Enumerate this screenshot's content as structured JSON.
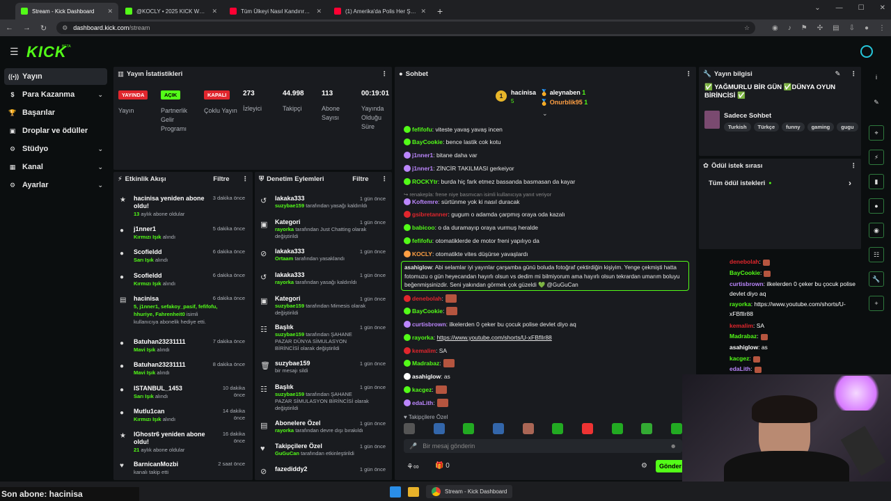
{
  "browser": {
    "tabs": [
      {
        "label": "Stream - Kick Dashboard",
        "color": "#53fc18"
      },
      {
        "label": "@KOCLY • 2025 KICK WRAPPE",
        "color": "#53fc18"
      },
      {
        "label": "Tüm Ülkeyi Nasıl Kandırırsın? -",
        "color": "#ff0033"
      },
      {
        "label": "(1) Amerika'da Polis Her Şeyi G",
        "color": "#ff0033"
      }
    ],
    "url_host": "dashboard.kick.com",
    "url_path": "/stream"
  },
  "app": {
    "logo": "KICK",
    "beta": "BETA"
  },
  "sidebar": [
    {
      "label": "Yayın",
      "icon": "broadcast-icon",
      "selected": true
    },
    {
      "label": "Para Kazanma",
      "icon": "dollar-icon",
      "chevron": true
    },
    {
      "label": "Başarılar",
      "icon": "trophy-icon"
    },
    {
      "label": "Droplar ve ödüller",
      "icon": "gift-icon"
    },
    {
      "label": "Stüdyo",
      "icon": "settings-icon",
      "chevron": true
    },
    {
      "label": "Kanal",
      "icon": "channel-icon",
      "chevron": true
    },
    {
      "label": "Ayarlar",
      "icon": "gear-icon",
      "chevron": true
    }
  ],
  "stats": {
    "title": "Yayın İstatistikleri",
    "items": [
      {
        "pill": "YAYINDA",
        "color": "#e1262d",
        "label": "Yayın"
      },
      {
        "pill": "AÇIK",
        "color": "#53fc18",
        "label": "Partnerlik Gelir Programı"
      },
      {
        "pill": "KAPALI",
        "color": "#e1262d",
        "label": "Çoklu Yayın"
      },
      {
        "value": "273",
        "label": "İzleyici"
      },
      {
        "value": "44.998",
        "label": "Takipçi"
      },
      {
        "value": "113",
        "label": "Abone Sayısı"
      },
      {
        "value": "00:19:01",
        "label": "Yayında Olduğu Süre"
      }
    ]
  },
  "activity": {
    "title": "Etkinlik Akışı",
    "filter": "Filtre",
    "rows": [
      {
        "name": "hacinisa yeniden abone oldu!",
        "sub_hi": "13",
        "sub": " aylık abone oldular",
        "time": "3 dakika önce"
      },
      {
        "name": "j1nner1",
        "sub_hi": "Kırmızı Işık",
        "sub": " alındı",
        "time": "5 dakika önce"
      },
      {
        "name": "Scofieldd",
        "sub_hi": "Sarı Işık",
        "sub": " alındı",
        "time": "6 dakika önce"
      },
      {
        "name": "Scofieldd",
        "sub_hi": "Kırmızı Işık",
        "sub": " alındı",
        "time": "6 dakika önce"
      },
      {
        "name": "hacinisa",
        "sub_hi": "5, j1nner1, sefakoy_pasif, fefifofu, hhuriye, Fahrenheit0",
        "sub": " isimli kullanıcıya abonelik hediye etti.",
        "time": "6 dakika önce"
      },
      {
        "name": "Batuhan23231111",
        "sub_hi": "Mavi Işık",
        "sub": " alındı",
        "time": "7 dakika önce"
      },
      {
        "name": "Batuhan23231111",
        "sub_hi": "Mavi Işık",
        "sub": " alındı",
        "time": "8 dakika önce"
      },
      {
        "name": "ISTANBUL_1453",
        "sub_hi": "Sarı Işık",
        "sub": " alındı",
        "time": "10 dakika önce"
      },
      {
        "name": "Mutlu1can",
        "sub_hi": "Kırmızı Işık",
        "sub": " alındı",
        "time": "14 dakika önce"
      },
      {
        "name": "lGhostr6 yeniden abone oldu!",
        "sub_hi": "21",
        "sub": " aylık abone oldular",
        "time": "16 dakika önce"
      },
      {
        "name": "BarnicanMozbi",
        "sub_hi": "",
        "sub": "kanalı takip etti",
        "time": "2 saat önce"
      }
    ]
  },
  "moderation": {
    "title": "Denetim Eylemleri",
    "filter": "Filtre",
    "rows": [
      {
        "name": "lakaka333",
        "hi": "suzybae159",
        "sub": " tarafından yasağı kaldırıldı",
        "time": "1 gün önce"
      },
      {
        "name": "Kategori",
        "hi": "rayorka",
        "sub": " tarafından Just Chatting olarak değiştirildi",
        "time": "1 gün önce"
      },
      {
        "name": "lakaka333",
        "hi": "Ortaam",
        "sub": " tarafından yasaklandı",
        "time": "1 gün önce"
      },
      {
        "name": "lakaka333",
        "hi": "rayorka",
        "sub": " tarafından yasağı kaldırıldı",
        "time": "1 gün önce"
      },
      {
        "name": "Kategori",
        "hi": "suzybae159",
        "sub": " tarafından Mimesis olarak değiştirildi",
        "time": "1 gün önce"
      },
      {
        "name": "Başlık",
        "hi": "suzybae159",
        "sub": " tarafından ŞAHANE PAZAR DÜNYA SİMULASYON BİRİNCİSİ olarak değiştirildi",
        "time": "1 gün önce"
      },
      {
        "name": "suzybae159",
        "hi": "",
        "sub": "bir mesajı sildi",
        "time": "1 gün önce"
      },
      {
        "name": "Başlık",
        "hi": "suzybae159",
        "sub": " tarafından ŞAHANE PAZAR SİMULASYON BİRİNCİSİ olarak değiştirildi",
        "time": "1 gün önce"
      },
      {
        "name": "Abonelere Özel",
        "hi": "rayorka",
        "sub": " tarafından devre dışı bırakıldı",
        "time": "1 gün önce"
      },
      {
        "name": "Takipçilere Özel",
        "hi": "GuGuCan",
        "sub": " tarafından etkinleştirildi",
        "time": "1 gün önce"
      },
      {
        "name": "fazediddy2",
        "hi": "",
        "sub": "",
        "time": "1 gün önce"
      }
    ]
  },
  "chat": {
    "title": "Sohbet",
    "top": [
      {
        "name": "hacinisa",
        "count": "5"
      },
      {
        "name": "aleynaben",
        "count": "1"
      },
      {
        "name": "Onurblik95",
        "count": "1"
      }
    ],
    "lines": [
      {
        "user": "fefifofu",
        "color": "#53fc18",
        "text": ": viteste yavaş yavaş incen"
      },
      {
        "user": "BayCookie",
        "color": "#53fc18",
        "text": ": bence lastik cok kotu"
      },
      {
        "user": "j1nner1",
        "color": "#bb86fc",
        "text": ": bitane daha var"
      },
      {
        "user": "j1nner1",
        "color": "#bb86fc",
        "text": ": ZİNCİR TAKILMASI gerkeiyor"
      },
      {
        "user": "ROCKYtr",
        "color": "#53fc18",
        "text": ": burda hiç fark etmez bassanda basmasan da kayar"
      },
      {
        "user": "",
        "color": "#888",
        "text": "↪ renakepla: frene niye basmıcan isimli kullanıcıya yanıt veriyor"
      },
      {
        "user": "Koftemre",
        "color": "#bb86fc",
        "text": ": sürtünme yok ki nasıl duracak"
      },
      {
        "user": "gsibretanner",
        "color": "#e1262d",
        "text": ": gugum o adamda çarpmış oraya oda kazalı"
      },
      {
        "user": "babicoo",
        "color": "#53fc18",
        "text": ": o da duramayıp oraya vurmuş heralde"
      },
      {
        "user": "fefifofu",
        "color": "#53fc18",
        "text": ": otomatiklerde de motor freni yapılıyo da"
      },
      {
        "user": "KOCLY",
        "color": "#ff9f43",
        "text": ": otomatikte vites düşürse yavaşlardı"
      }
    ],
    "highlight": {
      "user": "asahiglow",
      "text": ": Abi selamlar iyi yayınlar çarşamba günü boluda fotoğraf çektirdiğin kişiyim. Yenge çekmişti hatta fotomuzu o gün heyecandan hayırlı olsun vs dedim mi bilmiyorum ama hayırlı olsun tekrardan umarım boluyu beğenmişsinizdir. Seni yakından görmek çok güzeldi 💚 @GuGuCan"
    },
    "lines2": [
      {
        "user": "denebolah",
        "color": "#e1262d",
        "text": ":"
      },
      {
        "user": "BayCookie",
        "color": "#53fc18",
        "text": ":"
      },
      {
        "user": "curtisbrown",
        "color": "#bb86fc",
        "text": ": ilkelerden 0 çeker bu çocuk polise devlet diyo aq"
      },
      {
        "user": "rayorka",
        "color": "#53fc18",
        "text": ": ",
        "link": "https://www.youtube.com/shorts/U-xFBflIr88"
      },
      {
        "user": "kemalim",
        "color": "#e1262d",
        "text": ": SA"
      },
      {
        "user": "Madrabaz",
        "color": "#53fc18",
        "text": ":"
      },
      {
        "user": "asahiglow",
        "color": "#ffffff",
        "text": ": as"
      },
      {
        "user": "kacgez",
        "color": "#53fc18",
        "text": ":"
      },
      {
        "user": "edaLith",
        "color": "#bb86fc",
        "text": ":"
      }
    ],
    "followers_only": "Takipçilere Özel",
    "input_placeholder": "Bir mesaj gönderin",
    "points": "0",
    "send": "Gönder"
  },
  "info": {
    "title": "Yayın bilgisi",
    "stream_title": "✅ YAĞMURLU BİR GÜN ✅DÜNYA OYUN BİRİNCİSİ ✅",
    "category": "Sadece Sohbet",
    "tags": [
      "Turkish",
      "Türkçe",
      "funny",
      "gaming",
      "gugu"
    ]
  },
  "rewards": {
    "title": "Ödül istek sırası",
    "all": "Tüm ödül istekleri"
  },
  "overlay_chat": [
    {
      "user": "denebolah",
      "color": "#e1262d",
      "text": ":"
    },
    {
      "user": "BayCookie",
      "color": "#53fc18",
      "text": ":"
    },
    {
      "user": "curtisbrown",
      "color": "#bb86fc",
      "text": ": ilkelerden 0 çeker bu çocuk polise"
    },
    {
      "user": "",
      "color": "#fff",
      "text": "devlet diyo aq"
    },
    {
      "user": "rayorka",
      "color": "#53fc18",
      "text": ": https://www.youtube.com/shorts/U-"
    },
    {
      "user": "",
      "color": "#fff",
      "text": "xFBflIr88"
    },
    {
      "user": "kemalim",
      "color": "#e1262d",
      "text": ": SA"
    },
    {
      "user": "Madrabaz",
      "color": "#53fc18",
      "text": ":"
    },
    {
      "user": "asahiglow",
      "color": "#fff",
      "text": ": as"
    },
    {
      "user": "kacgez",
      "color": "#53fc18",
      "text": ":"
    },
    {
      "user": "edaLith",
      "color": "#bb86fc",
      "text": ":"
    }
  ],
  "footer": {
    "last_sub": "Son abone: hacinisa",
    "taskbar_item": "Stream - Kick Dashboard"
  }
}
